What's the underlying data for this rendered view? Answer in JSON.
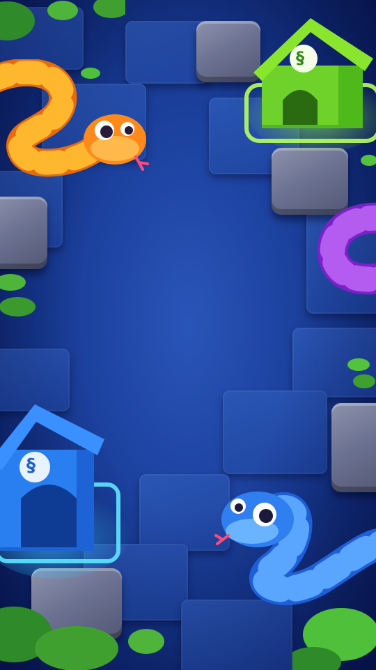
{
  "scene": {
    "type": "snake-puzzle-board",
    "theme_colors": {
      "board": "#1f46a6",
      "rock": "#6d7392",
      "leaf": "#3fae3a"
    }
  },
  "houses": [
    {
      "color": "green",
      "accent": "#7ee021",
      "icon": "snake-icon"
    },
    {
      "color": "blue",
      "accent": "#2f8cff",
      "icon": "snake-icon"
    }
  ],
  "snakes": [
    {
      "color": "orange",
      "hex": "#ff8a1a"
    },
    {
      "color": "purple",
      "hex": "#9b3fe0"
    },
    {
      "color": "blue",
      "hex": "#2f7ff0"
    }
  ]
}
